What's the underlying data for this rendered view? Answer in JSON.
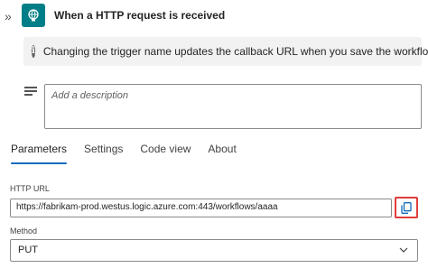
{
  "trigger": {
    "title": "When a HTTP request is received",
    "icon": "http-request-icon",
    "tile_color": "#007e87"
  },
  "info_bar": {
    "message": "Changing the trigger name updates the callback URL when you save the workflow."
  },
  "description": {
    "placeholder": "Add a description"
  },
  "tabs": [
    {
      "label": "Parameters",
      "active": true
    },
    {
      "label": "Settings",
      "active": false
    },
    {
      "label": "Code view",
      "active": false
    },
    {
      "label": "About",
      "active": false
    }
  ],
  "parameters": {
    "http_url_label": "HTTP URL",
    "http_url_value": "https://fabrikam-prod.westus.logic.azure.com:443/workflows/aaaa",
    "method_label": "Method",
    "method_value": "PUT"
  },
  "colors": {
    "accent": "#0f6cbd",
    "highlight": "#e03c3c"
  }
}
